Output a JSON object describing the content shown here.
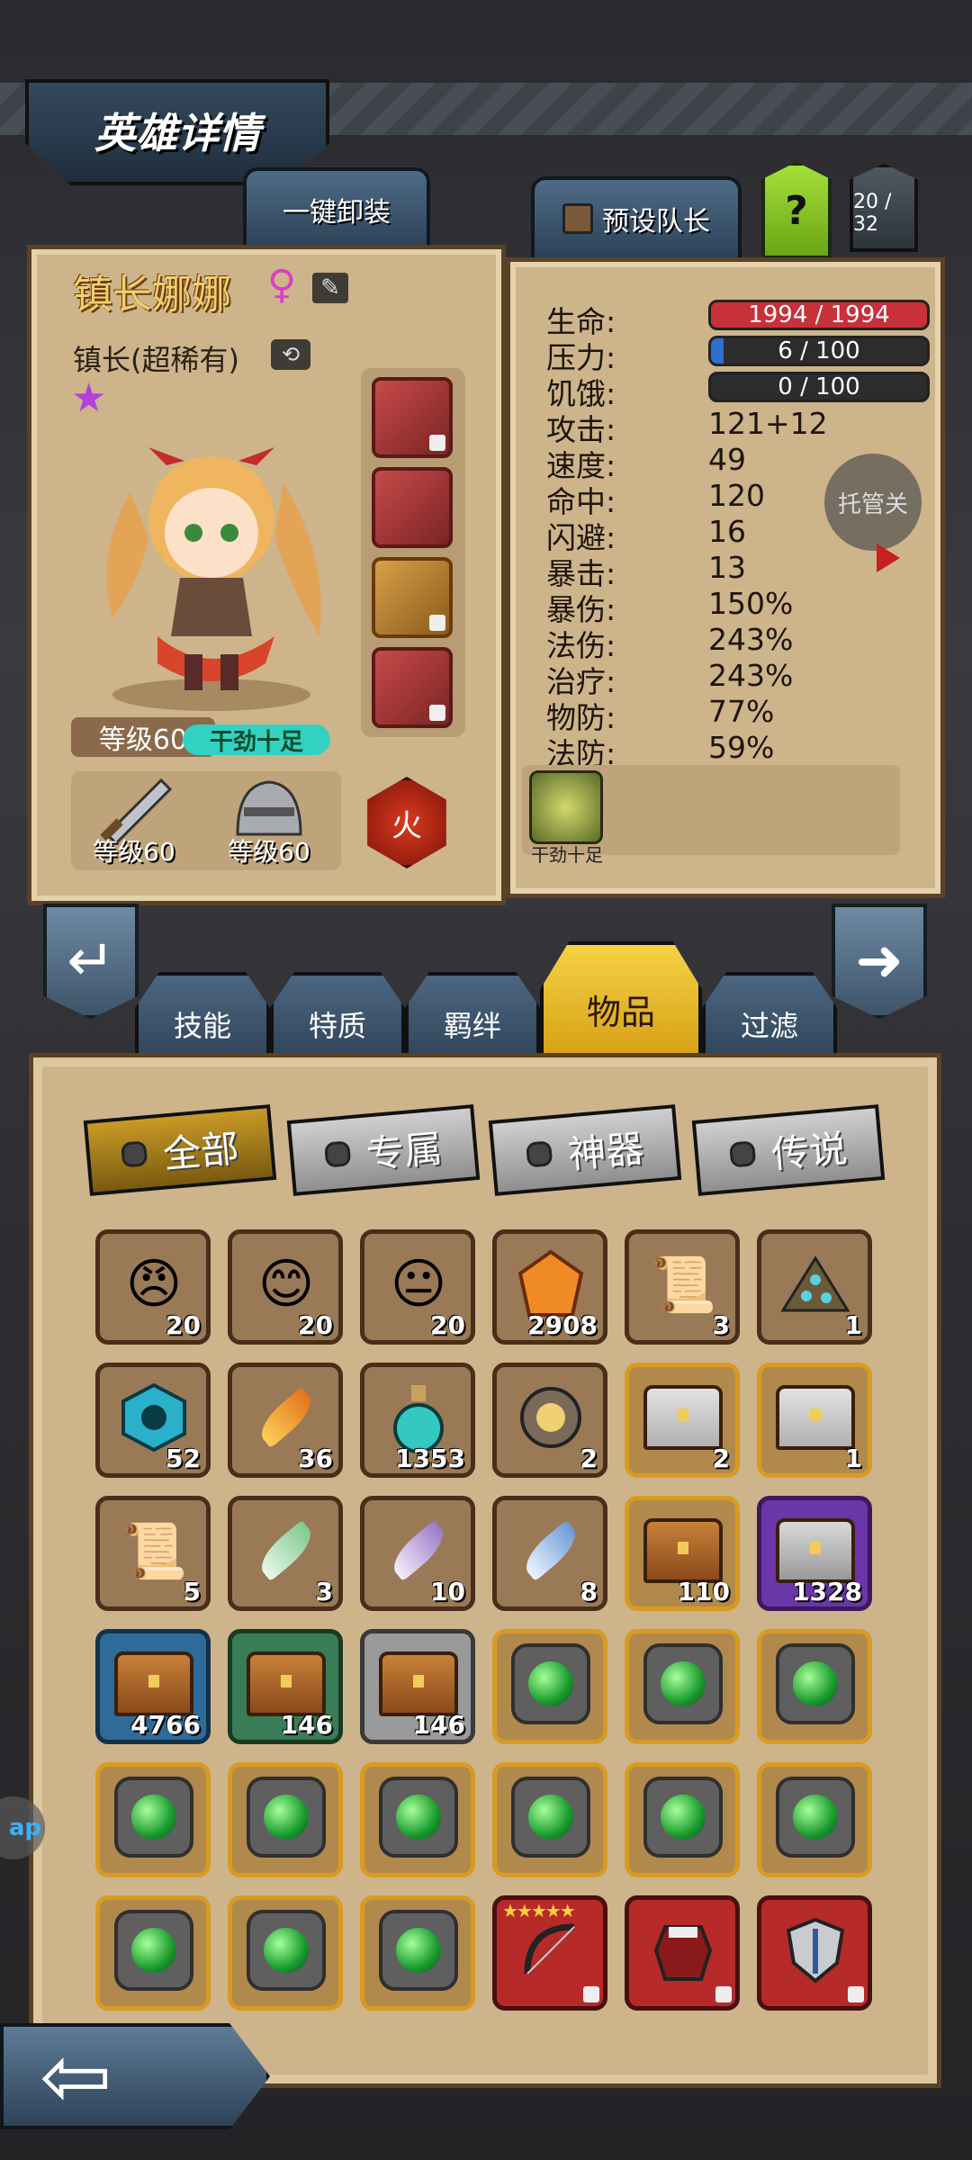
{
  "header": {
    "title": "英雄详情",
    "unequip_all_label": "一键卸装",
    "preset_captain_label": "预设队长",
    "help_label": "?",
    "page_count": "20 / 32"
  },
  "hero": {
    "name": "镇长娜娜",
    "gender_symbol": "♀",
    "class_label": "镇长(超稀有)",
    "rarity_star": "★",
    "level_label": "等级60",
    "trait_label": "干劲十足",
    "weapon_level": "等级60",
    "armor_level": "等级60",
    "element_label": "火"
  },
  "stats": {
    "hp_label": "生命:",
    "hp_value": "1994 / 1994",
    "hp_fraction": 1.0,
    "stress_label": "压力:",
    "stress_value": "6 / 100",
    "stress_fraction": 0.06,
    "hunger_label": "饥饿:",
    "hunger_value": "0 / 100",
    "hunger_fraction": 0.0,
    "rows": [
      {
        "label": "攻击:",
        "value": "121+12"
      },
      {
        "label": "速度:",
        "value": "49"
      },
      {
        "label": "命中:",
        "value": "120"
      },
      {
        "label": "闪避:",
        "value": "16"
      },
      {
        "label": "暴击:",
        "value": "13"
      },
      {
        "label": "暴伤:",
        "value": "150%"
      },
      {
        "label": "法伤:",
        "value": "243%"
      },
      {
        "label": "治疗:",
        "value": "243%"
      },
      {
        "label": "物防:",
        "value": "77%"
      },
      {
        "label": "法防:",
        "value": "59%"
      }
    ],
    "auto_label": "托管关",
    "skill_label": "干劲十足"
  },
  "tabs": {
    "skills": "技能",
    "traits": "特质",
    "bonds": "羁绊",
    "items": "物品",
    "filter": "过滤"
  },
  "filters": {
    "all": "全部",
    "exclusive": "专属",
    "artifact": "神器",
    "legendary": "传说"
  },
  "inventory": {
    "row1": [
      "20",
      "20",
      "20",
      "2908",
      "3",
      "1"
    ],
    "row2": [
      "52",
      "36",
      "1353",
      "2",
      "2",
      "1"
    ],
    "row3": [
      "5",
      "3",
      "10",
      "8",
      "110",
      "1328"
    ],
    "row4": [
      "4766",
      "146",
      "146",
      "",
      "",
      ""
    ]
  },
  "side_bubble": "ap",
  "colors": {
    "hp_bar": "#c8303a",
    "stress_bar": "#2f6fd0",
    "panel": "#cdb48b",
    "gold_tab": "#f4d244"
  }
}
